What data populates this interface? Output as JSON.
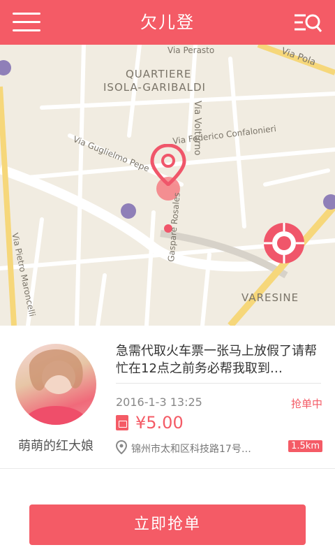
{
  "header": {
    "title": "欠儿登"
  },
  "map": {
    "labels": {
      "via_perasto": "Via Perasto",
      "via_pola": "Via Pola",
      "quartiere_line1": "QUARTIERE",
      "quartiere_line2": "ISOLA-GARIBALDI",
      "via_volturno": "Via Volturno",
      "via_federico": "Via Federico Confalonieri",
      "via_guglielmo": "Via Guglielmo Pepe",
      "via_pietro": "Via Pietro Maroncelli",
      "gaspare": "Gaspare Rosales",
      "varesine": "VARESINE"
    }
  },
  "task": {
    "username": "萌萌的红大娘",
    "description": "急需代取火车票一张马上放假了请帮忙在12点之前务必帮我取到…",
    "datetime": "2016-1-3  13:25",
    "status": "抢单中",
    "price": "¥5.00",
    "address": "锦州市太和区科技路17号…",
    "distance": "1.5km"
  },
  "actions": {
    "grab_label": "立即抢单"
  },
  "colors": {
    "accent": "#f45b66"
  }
}
